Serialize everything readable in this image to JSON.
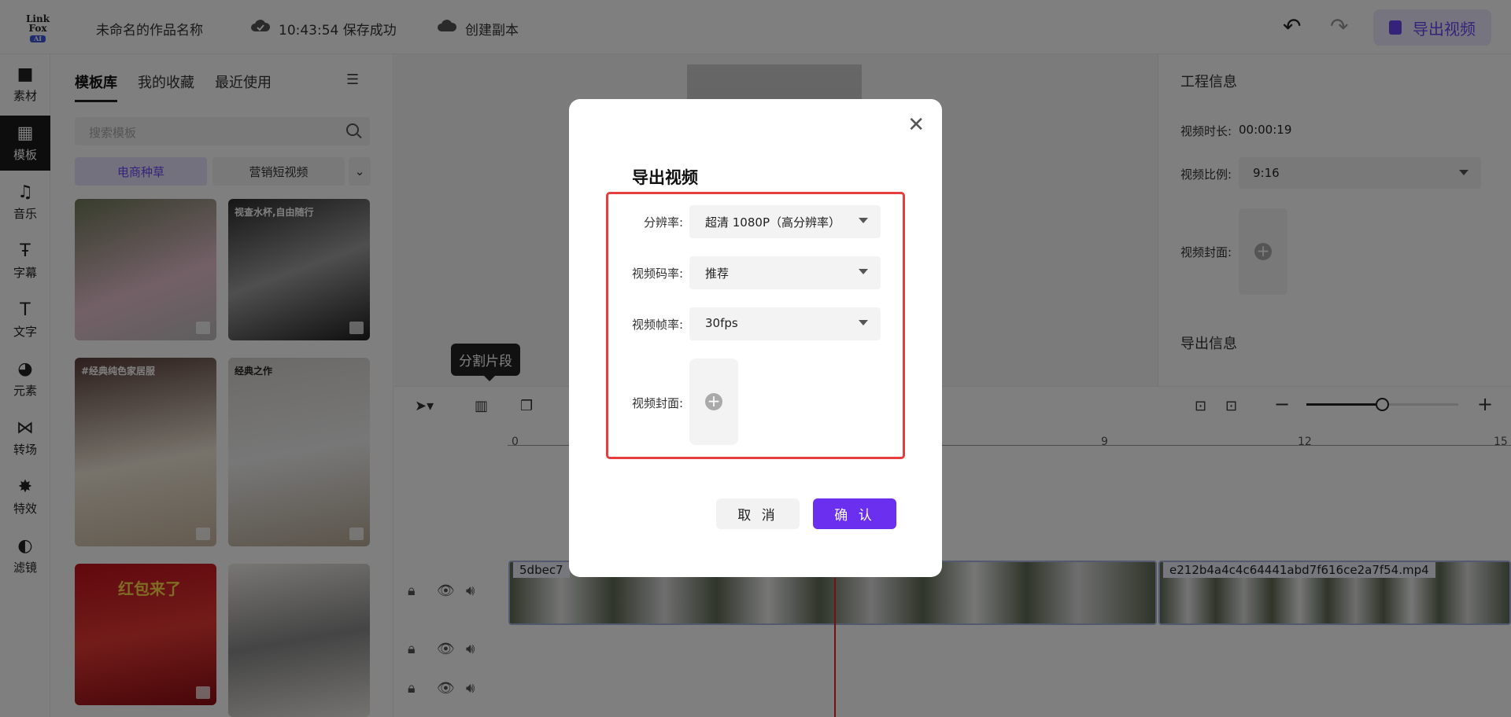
{
  "app": {
    "logo_line1": "Link",
    "logo_line2": "Fox",
    "logo_badge": "AI",
    "project_name": "未命名的作品名称",
    "save_status": "10:43:54 保存成功",
    "create_copy": "创建副本",
    "export_label": "导出视频",
    "accent_color": "#6b47f5"
  },
  "rail": [
    {
      "label": "素材",
      "icon": "folder-icon"
    },
    {
      "label": "模板",
      "icon": "template-icon"
    },
    {
      "label": "音乐",
      "icon": "music-icon"
    },
    {
      "label": "字幕",
      "icon": "subtitle-icon"
    },
    {
      "label": "文字",
      "icon": "text-icon"
    },
    {
      "label": "元素",
      "icon": "element-icon"
    },
    {
      "label": "转场",
      "icon": "transition-icon"
    },
    {
      "label": "特效",
      "icon": "effect-icon"
    },
    {
      "label": "滤镜",
      "icon": "filter-icon"
    }
  ],
  "panel": {
    "tabs": [
      "模板库",
      "我的收藏",
      "最近使用"
    ],
    "search_placeholder": "搜索模板",
    "categories": [
      "电商种草",
      "营销短视频"
    ],
    "thumb_texts": [
      "",
      "视查水杯,自由随行",
      "#经典纯色家居服",
      "经典之作",
      "红包来了",
      ""
    ]
  },
  "preview": {
    "tooltip": "分割片段"
  },
  "info": {
    "project_title": "工程信息",
    "duration_label": "视频时长:",
    "duration_value": "00:00:19",
    "ratio_label": "视频比例:",
    "ratio_value": "9:16",
    "cover_label": "视频封面:",
    "export_title": "导出信息"
  },
  "timeline": {
    "ticks": [
      "0",
      "9",
      "12",
      "15"
    ],
    "clip1": "5dbec7",
    "clip2": "e212b4a4c4c64441abd7f616ce2a7f54.mp4"
  },
  "modal": {
    "title": "导出视频",
    "resolution_label": "分辨率:",
    "resolution_value": "超清 1080P（高分辨率）",
    "bitrate_label": "视频码率:",
    "bitrate_value": "推荐",
    "fps_label": "视频帧率:",
    "fps_value": "30fps",
    "cover_label": "视频封面:",
    "cancel_label": "取 消",
    "confirm_label": "确 认"
  }
}
